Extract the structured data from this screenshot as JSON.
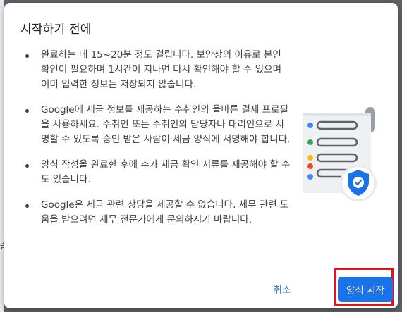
{
  "background": {
    "partial_char": "습"
  },
  "dialog": {
    "title": "시작하기 전에",
    "bullets": [
      {
        "text": "완료하는 데 15~20분 정도 걸립니다. 보안상의 이유로 본인 확인이 필요하며 1시간이 지나면 다시 확인해야 할 수 있으며 이미 입력한 정보는 저장되지 않습니다."
      },
      {
        "text": "Google에 세금 정보를 제공하는 수취인의 올바른 결제 프로필을 사용하세요. 수취인 또는 수취인의 담당자나 대리인으로 서명할 수 있도록 승인 받은 사람이 세금 양식에 서명해야 합니다."
      },
      {
        "text": "양식 작성을 완료한 후에 추가 세금 확인 서류를 제공해야 할 수도 있습니다."
      },
      {
        "text": "Google은 세금 관련 상담을 제공할 수 없습니다. 세무 관련 도움을 받으려면 세무 전문가에게 문의하시기 바랍니다."
      }
    ],
    "illustration": {
      "icon": "tax-form-shield-icon",
      "dot_colors": [
        "#4285f4",
        "#34a853",
        "#fbbc04",
        "#ea4335",
        "#4285f4"
      ]
    },
    "actions": {
      "cancel_label": "취소",
      "start_label": "양식 시작"
    }
  },
  "colors": {
    "primary": "#1a73e8",
    "highlight": "#e2141b",
    "text": "#3c4043"
  }
}
